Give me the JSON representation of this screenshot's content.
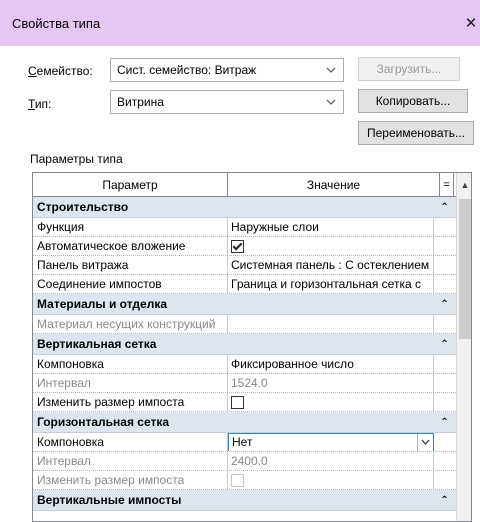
{
  "window": {
    "title": "Свойства типа",
    "close_glyph": "✕"
  },
  "family": {
    "label_underline": "С",
    "label_rest": "емейство:",
    "value": "Сист. семейство: Витраж",
    "load_button": "Загрузить..."
  },
  "type": {
    "label_underline": "Т",
    "label_rest": "ип:",
    "value": "Витрина",
    "copy_button": "Копировать...",
    "rename_button": "Переименовать..."
  },
  "params_label": "Параметры типа",
  "grid": {
    "header_param": "Параметр",
    "header_value": "Значение",
    "header_eq": "=",
    "groups": [
      {
        "title": "Строительство",
        "rows": [
          {
            "param": "Функция",
            "value": "Наружные слои"
          },
          {
            "param": "Автоматическое вложение",
            "value": ""
          },
          {
            "param": "Панель витража",
            "value": "Системная панель : С остеклением"
          },
          {
            "param": "Соединение импостов",
            "value": "Граница и горизонтальная сетка с"
          }
        ]
      },
      {
        "title": "Материалы и отделка",
        "rows": [
          {
            "param": "Материал несущих конструкций",
            "value": ""
          }
        ]
      },
      {
        "title": "Вертикальная сетка",
        "rows": [
          {
            "param": "Компоновка",
            "value": "Фиксированное число"
          },
          {
            "param": "Интервал",
            "value": "1524.0"
          },
          {
            "param": "Изменить размер импоста",
            "value": ""
          }
        ]
      },
      {
        "title": "Горизонтальная сетка",
        "rows": [
          {
            "param": "Компоновка",
            "value": "Нет"
          },
          {
            "param": "Интервал",
            "value": "2400.0"
          },
          {
            "param": "Изменить размер импоста",
            "value": ""
          }
        ]
      },
      {
        "title": "Вертикальные импосты",
        "rows": []
      }
    ]
  },
  "icons": {
    "collapse": "⌃",
    "chevron": "⌄",
    "scroll_up": "▲"
  }
}
